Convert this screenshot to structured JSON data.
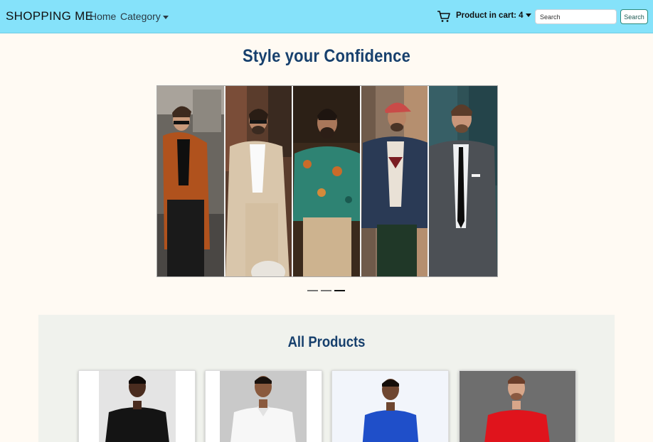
{
  "navbar": {
    "brand": "SHOPPING ME",
    "home_label": "Home",
    "category_label": "Category",
    "cart_icon": "shopping-cart-icon",
    "cart_label": "Product in cart: 4",
    "search_placeholder": "Search",
    "search_button_label": "Search",
    "background_color": "#85e2fa"
  },
  "hero": {
    "title": "Style your Confidence",
    "title_color": "#17406d",
    "slides": [
      {
        "name": "man in rust blazer and sunglasses"
      },
      {
        "name": "man in beige double-breasted suit"
      },
      {
        "name": "man in patterned teal shirt"
      },
      {
        "name": "man in red cap and navy jacket"
      },
      {
        "name": "man in grey suit and black tie"
      }
    ],
    "indicators": [
      {
        "active": false
      },
      {
        "active": false
      },
      {
        "active": true
      }
    ]
  },
  "products": {
    "title": "All Products",
    "items": [
      {
        "name": "black shirt",
        "color": "#141414",
        "bg": "#e4e4e4"
      },
      {
        "name": "white shirt",
        "color": "#f7f7f7",
        "bg": "#c9c9c9"
      },
      {
        "name": "blue shirt",
        "color": "#1f4fc9",
        "bg": "#f2f5fb"
      },
      {
        "name": "red shirt",
        "color": "#e0141c",
        "bg": "#6e6e6e"
      }
    ]
  }
}
